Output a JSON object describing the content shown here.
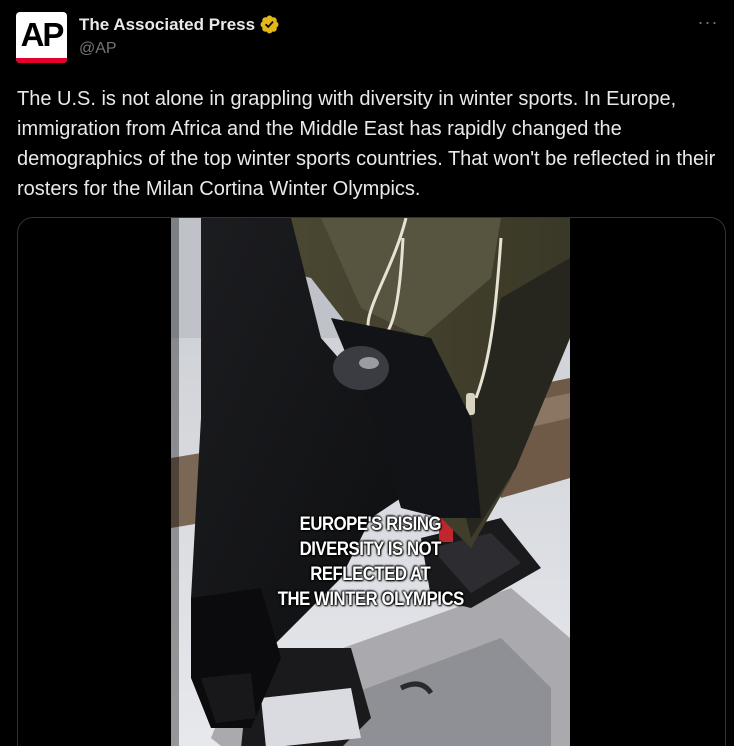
{
  "post": {
    "author": {
      "name": "The Associated Press",
      "handle": "@AP",
      "avatar_logo": "AP",
      "verified_icon": "verified-gold-badge-icon"
    },
    "more_icon": "more-horizontal-icon",
    "more_label": "···",
    "text": "The U.S. is not alone in grappling with diversity in winter sports. In Europe, immigration from Africa and the Middle East has rapidly changed the demographics of the top winter sports countries. That won't be reflected in their rosters for the Milan Cortina Winter Olympics.",
    "media": {
      "type": "video",
      "caption_lines": [
        "EUROPE'S RISING",
        "DIVERSITY IS NOT",
        "REFLECTED AT",
        "THE WINTER OLYMPICS"
      ]
    }
  },
  "colors": {
    "background": "#000000",
    "text_primary": "#e7e9ea",
    "text_secondary": "#71767b",
    "border": "#2f3336",
    "verified_gold": "#e2b719",
    "ap_red": "#e4002b"
  }
}
